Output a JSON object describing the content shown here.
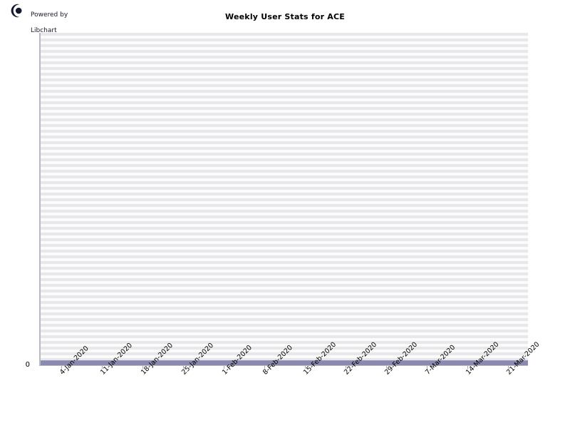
{
  "branding": {
    "logo_icon": "libchart-crescent-logo-icon",
    "text": "Powered by\nLibchart",
    "line1": "Powered by",
    "line2": "Libchart"
  },
  "header": {
    "title": "Weekly User Stats for ACE"
  },
  "colors": {
    "series": "#8a8ab0",
    "axis": "#b9b9c4",
    "grid_band_dark": "#e8e8ea",
    "grid_band_light": "#fbfbfc",
    "background": "#ffffff",
    "text": "#000000",
    "logo": "#1a1a2e"
  },
  "chart_data": {
    "type": "bar",
    "title": "Weekly User Stats for ACE",
    "xlabel": "",
    "ylabel": "",
    "categories": [
      "4-Jan-2020",
      "11-Jan-2020",
      "18-Jan-2020",
      "25-Jan-2020",
      "1-Feb-2020",
      "8-Feb-2020",
      "15-Feb-2020",
      "22-Feb-2020",
      "29-Feb-2020",
      "7-Mar-2020",
      "14-Mar-2020",
      "21-Mar-2020"
    ],
    "values": [
      0,
      0,
      0,
      0,
      0,
      0,
      0,
      0,
      0,
      0,
      0,
      0
    ],
    "ylim": [
      0,
      0
    ],
    "y_tick_labels": [
      "0"
    ],
    "y_tick_values": [
      0
    ],
    "grid": true,
    "legend": "none",
    "series_name": "Weekly User Stats"
  }
}
